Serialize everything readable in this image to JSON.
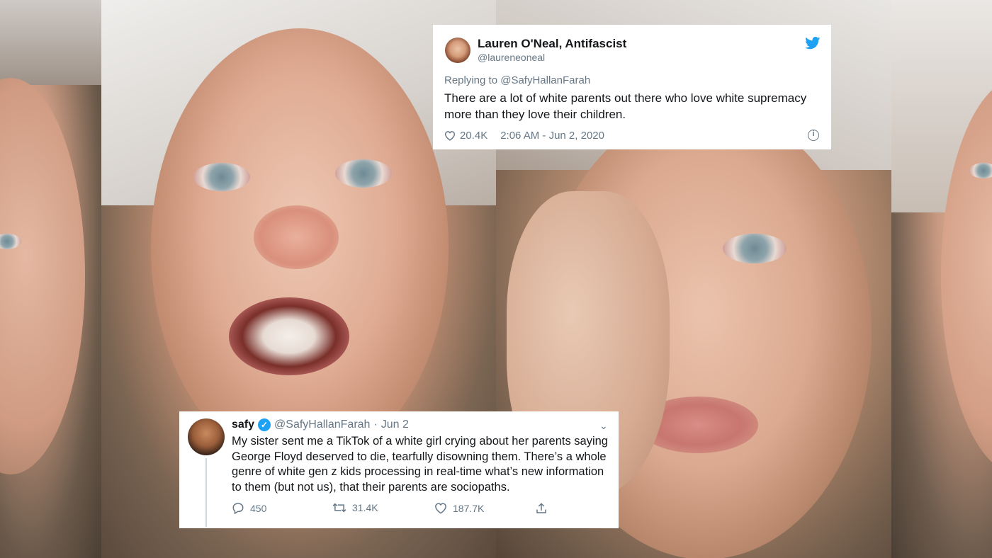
{
  "tweet_top": {
    "name": "Lauren O'Neal, Antifascist",
    "handle": "@laureneoneal",
    "replying_to": "Replying to @SafyHallanFarah",
    "text": "There are a lot of white parents out there who love white supremacy more than they love their children.",
    "likes": "20.4K",
    "timestamp": "2:06 AM - Jun 2, 2020",
    "icons": {
      "brand": "twitter-bird-icon",
      "like": "heart-icon",
      "info": "info-icon"
    }
  },
  "tweet_bottom": {
    "name": "safy",
    "handle": "@SafyHallanFarah",
    "separator": "·",
    "date": "Jun 2",
    "text": "My sister sent me a TikTok of a white girl crying about her parents saying George Floyd deserved to die, tearfully disowning them. There’s a whole genre of white gen z kids processing in real-time what’s new information to them (but not us), that their parents are sociopaths.",
    "replies": "450",
    "retweets": "31.4K",
    "likes": "187.7K",
    "icons": {
      "verified": "verified-badge-icon",
      "menu": "chevron-down-icon",
      "reply": "reply-icon",
      "retweet": "retweet-icon",
      "like": "heart-icon",
      "share": "share-icon"
    }
  },
  "colors": {
    "twitter_blue": "#1da1f2",
    "text": "#14171a",
    "secondary": "#657786"
  }
}
